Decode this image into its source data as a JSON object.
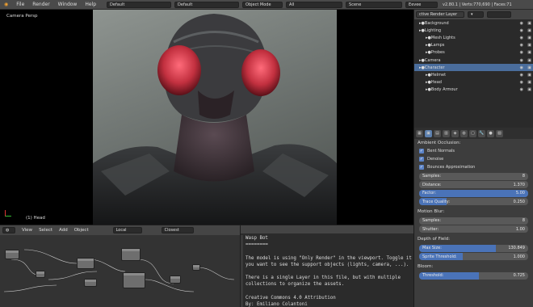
{
  "topbar": {
    "menus": [
      "File",
      "Render",
      "Window",
      "Help"
    ],
    "screen_layout": "Default",
    "scene_layout": "Default",
    "mode": "Object Mode",
    "filter": "All",
    "scene": "Scene",
    "engine": "Eevee",
    "stats": "v2.80.1 | Verts:770,690 | Faces:71"
  },
  "viewport": {
    "camera_label": "Camera Persp",
    "object_label": "(1) Head"
  },
  "outliner": {
    "layer": "ctive Render Layer",
    "rows": [
      {
        "label": "Background",
        "indent": 0,
        "selected": false
      },
      {
        "label": "Lighting",
        "indent": 0,
        "selected": false
      },
      {
        "label": "Mesh Lights",
        "indent": 1,
        "selected": false
      },
      {
        "label": "Lamps",
        "indent": 1,
        "selected": false
      },
      {
        "label": "Probes",
        "indent": 1,
        "selected": false
      },
      {
        "label": "Camera",
        "indent": 0,
        "selected": false
      },
      {
        "label": "Character",
        "indent": 0,
        "selected": true
      },
      {
        "label": "Helmet",
        "indent": 1,
        "selected": false
      },
      {
        "label": "Head",
        "indent": 1,
        "selected": false
      },
      {
        "label": "Body Armour",
        "indent": 1,
        "selected": false
      }
    ]
  },
  "properties": {
    "ambient_occlusion": {
      "title": "Ambient Occlusion:",
      "bent_normals": "Bent Normals",
      "denoise": "Denoise",
      "bounces": "Bounces Approximation",
      "samples_label": "Samples:",
      "samples_value": "8",
      "distance_label": "Distance:",
      "distance_value": "1.370",
      "factor_label": "Factor:",
      "factor_value": "5.00",
      "factor_fill": 1.0,
      "trace_label": "Trace Quality:",
      "trace_value": "0.250",
      "trace_fill": 0.25
    },
    "motion_blur": {
      "title": "Motion Blur:",
      "samples_label": "Samples:",
      "samples_value": "8",
      "shutter_label": "Shutter:",
      "shutter_value": "1.00"
    },
    "depth_of_field": {
      "title": "Depth of Field:",
      "max_label": "Max Size:",
      "max_value": "130.849",
      "max_fill": 0.7,
      "sprite_label": "Sprite Threshold:",
      "sprite_value": "1.000",
      "sprite_fill": 0.4
    },
    "bloom": {
      "title": "Bloom:",
      "threshold_label": "Threshold:",
      "threshold_value": "0.725",
      "threshold_fill": 0.55
    }
  },
  "node_editor": {
    "menus": [
      "View",
      "Select",
      "Add",
      "Object"
    ],
    "space": "Local",
    "mode": "Closest"
  },
  "text_editor": {
    "lines": [
      "Wasp Bot",
      "========",
      "",
      "The model is using \"Only Render\" in the viewport. Toggle it if",
      "you want to see the support objects (lights, camera, ...).",
      "",
      "There is a single Layer in this file, but with multiple",
      "collections to organize the assets.",
      "",
      "Creative Commons 4.0 Attribution",
      "By: Emiliano Colantoni"
    ]
  },
  "colors": {
    "accent": "#5b83c7",
    "selection": "#4a6d9c",
    "panel": "#3d3d3d"
  }
}
